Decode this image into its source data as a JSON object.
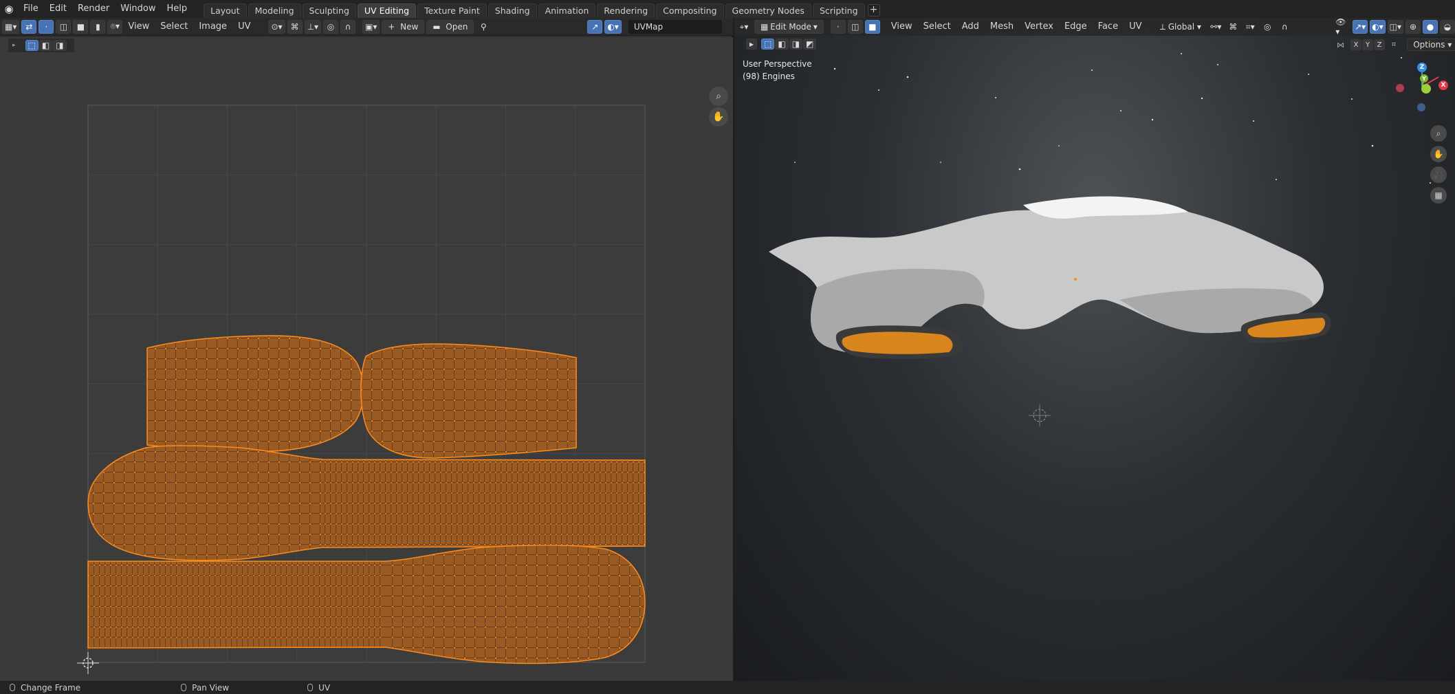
{
  "topbar": {
    "menus": [
      "File",
      "Edit",
      "Render",
      "Window",
      "Help"
    ],
    "tabs": [
      "Layout",
      "Modeling",
      "Sculpting",
      "UV Editing",
      "Texture Paint",
      "Shading",
      "Animation",
      "Rendering",
      "Compositing",
      "Geometry Nodes",
      "Scripting"
    ],
    "active_tab": "UV Editing",
    "add_tab": "+"
  },
  "uv_editor": {
    "menus": [
      "View",
      "Select",
      "Image",
      "UV"
    ],
    "new_label": "New",
    "open_label": "Open",
    "uvmap": "UVMap"
  },
  "viewport": {
    "mode": "Edit Mode",
    "menus": [
      "View",
      "Select",
      "Add",
      "Mesh",
      "Vertex",
      "Edge",
      "Face",
      "UV"
    ],
    "orientation": "Global",
    "options_label": "Options",
    "perspective": "User Perspective",
    "object": "(98) Engines",
    "axes": {
      "x": "X",
      "y": "Y",
      "z": "Z"
    },
    "mirror_axes": [
      "X",
      "Y",
      "Z"
    ]
  },
  "statusbar": {
    "left": "Change Frame",
    "middle": "Pan View",
    "right": "UV"
  },
  "colors": {
    "accent": "#4772b3",
    "uv_face": "#9a5a24",
    "uv_vertex": "#ff8c1a",
    "axis_x": "#e0384f",
    "axis_y": "#7bb82a",
    "axis_z": "#3b8fe0"
  }
}
